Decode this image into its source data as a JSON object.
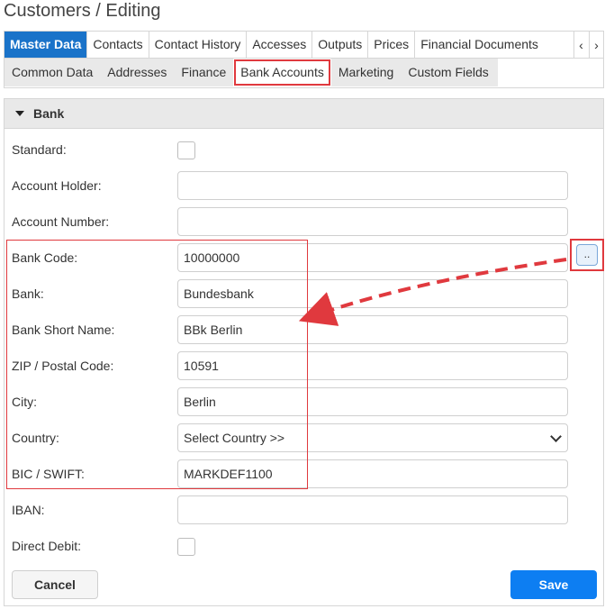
{
  "page_title": "Customers / Editing",
  "main_tabs": [
    "Master Data",
    "Contacts",
    "Contact History",
    "Accesses",
    "Outputs",
    "Prices",
    "Financial Documents"
  ],
  "main_tab_active": "Master Data",
  "sub_tabs": [
    "Common Data",
    "Addresses",
    "Finance",
    "Bank Accounts",
    "Marketing",
    "Custom Fields"
  ],
  "sub_tab_active": "Bank Accounts",
  "section_title": "Bank",
  "fields": {
    "standard": {
      "label": "Standard:",
      "checked": false
    },
    "account_holder": {
      "label": "Account Holder:",
      "value": ""
    },
    "account_number": {
      "label": "Account Number:",
      "value": ""
    },
    "bank_code": {
      "label": "Bank Code:",
      "value": "10000000"
    },
    "bank": {
      "label": "Bank:",
      "value": "Bundesbank"
    },
    "bank_short_name": {
      "label": "Bank Short Name:",
      "value": "BBk Berlin"
    },
    "zip": {
      "label": "ZIP / Postal Code:",
      "value": "10591"
    },
    "city": {
      "label": "City:",
      "value": "Berlin"
    },
    "country": {
      "label": "Country:",
      "value": "Select Country >>"
    },
    "bic": {
      "label": "BIC / SWIFT:",
      "value": "MARKDEF1100"
    },
    "iban": {
      "label": "IBAN:",
      "value": ""
    },
    "direct_debit": {
      "label": "Direct Debit:",
      "checked": false
    }
  },
  "lookup_button_label": "..",
  "buttons": {
    "cancel": "Cancel",
    "save": "Save"
  },
  "colors": {
    "accent": "#1a73c9",
    "save": "#0d7ef2",
    "annotation": "#e0393e"
  }
}
